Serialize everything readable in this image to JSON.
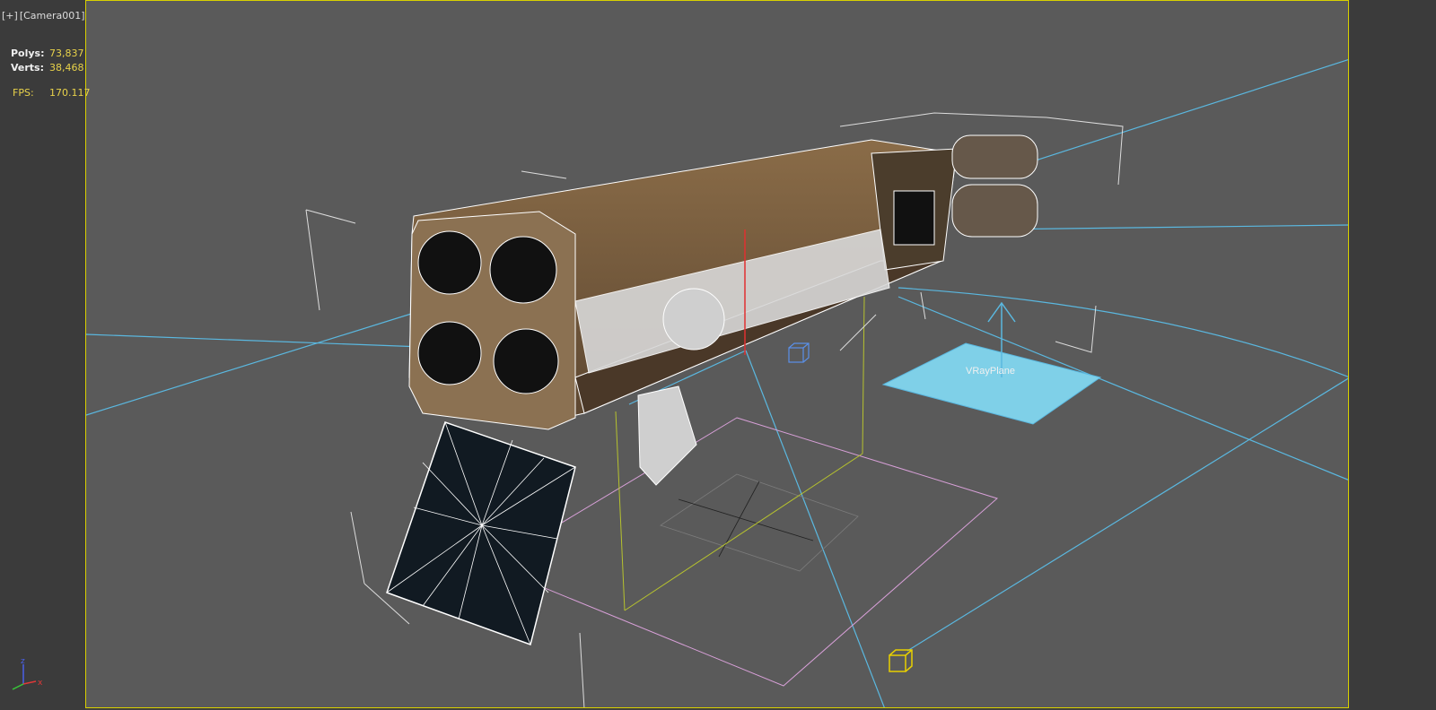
{
  "viewport": {
    "menu_plus": "[+]",
    "camera_label": "[Camera001]"
  },
  "stats": {
    "polys_label": "Polys:",
    "polys_value": "73,837",
    "verts_label": "Verts:",
    "verts_value": "38,468",
    "fps_label": "FPS:",
    "fps_value": "170.117"
  },
  "scene": {
    "vray_plane_label": "VRayPlane"
  },
  "gizmo": {
    "z_label": "z",
    "x_label": "x"
  },
  "colors": {
    "viewport_bg": "#5a5a5a",
    "panel_bg": "#3b3b3b",
    "active_border": "#d8d000",
    "light_blue": "#5ab8e0",
    "wire_white": "#ffffff",
    "model_brown": "#7a6040",
    "stats_value": "#e8d24a"
  }
}
